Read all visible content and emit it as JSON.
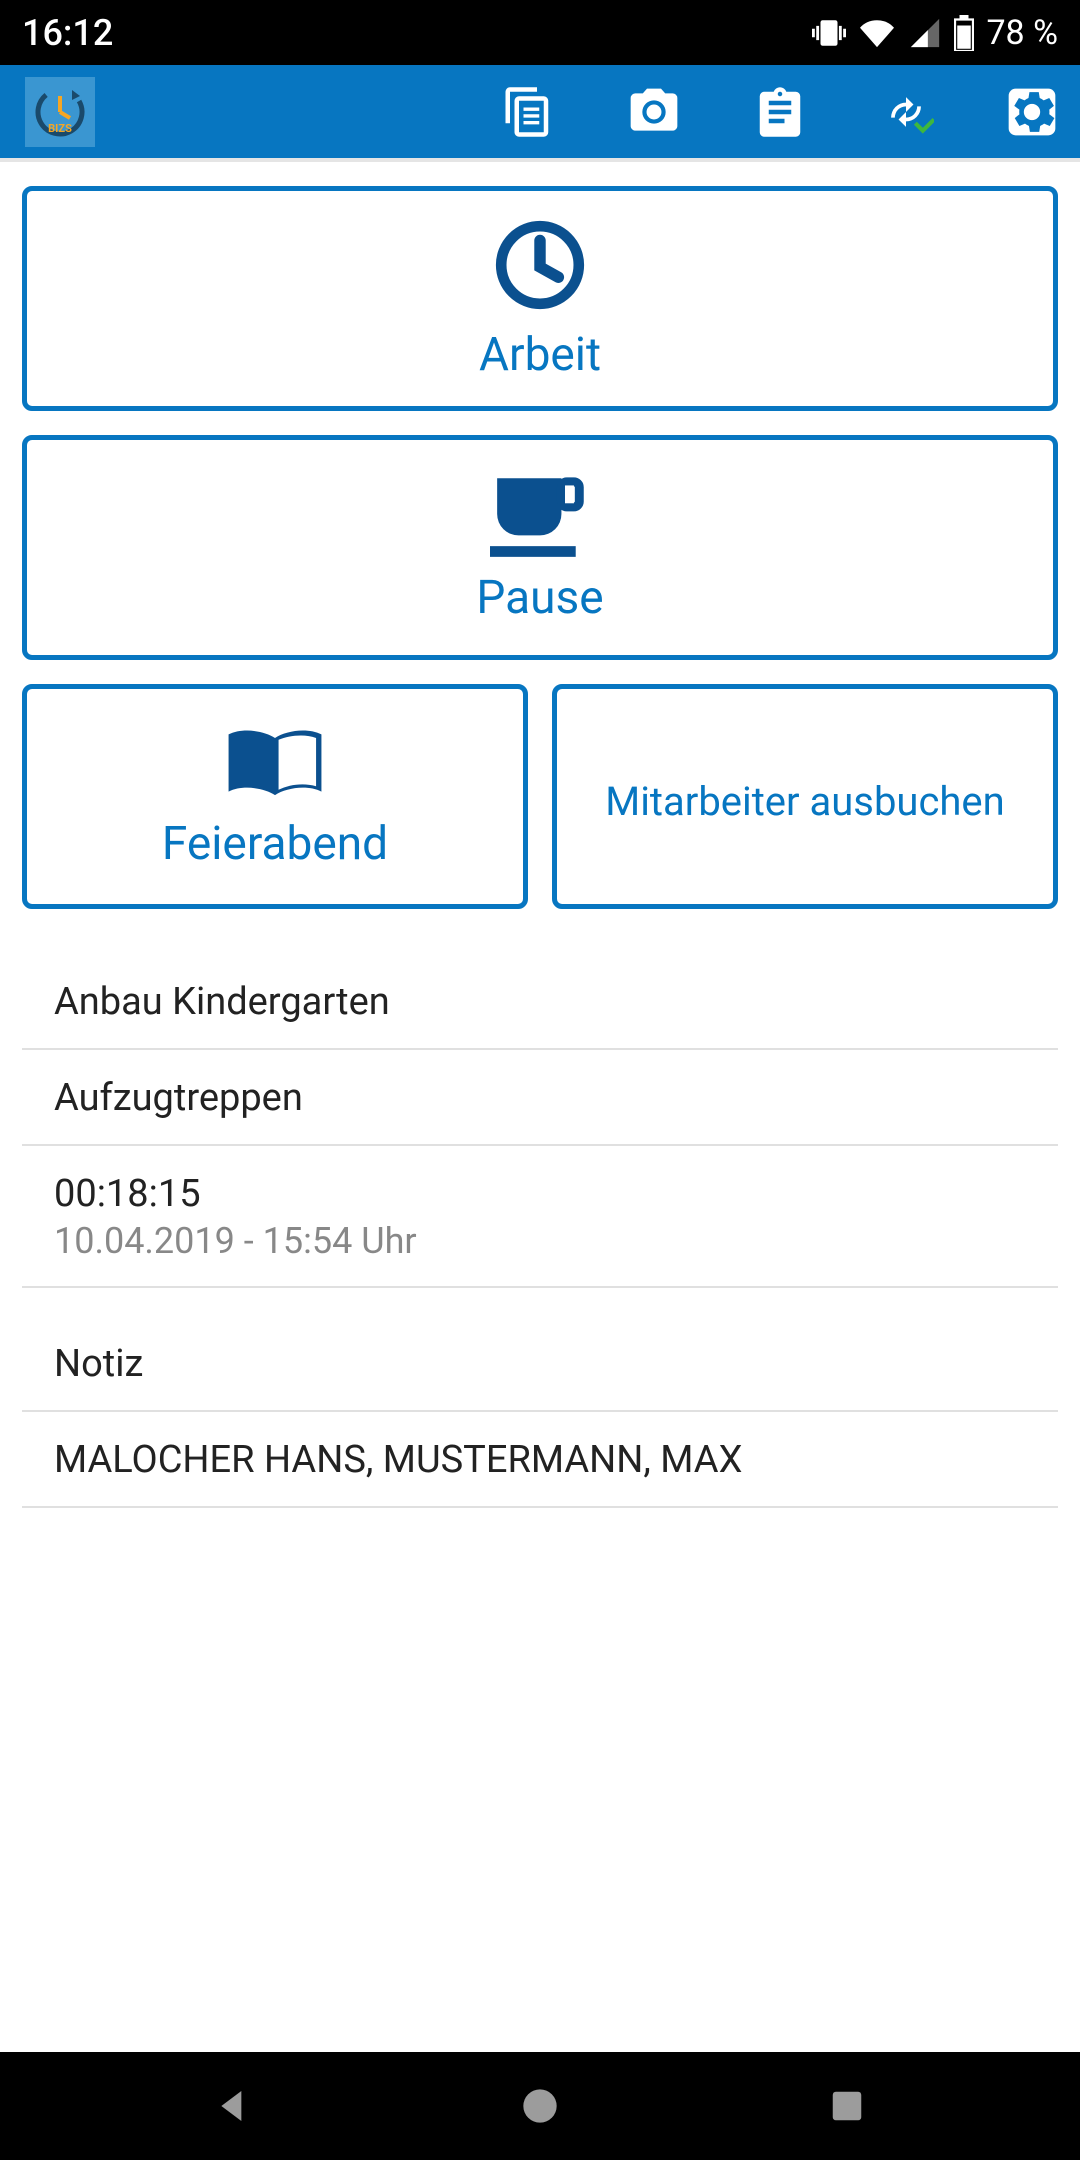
{
  "statusbar": {
    "time": "16:12",
    "battery": "78 %"
  },
  "buttons": {
    "arbeit": "Arbeit",
    "pause": "Pause",
    "feierabend": "Feierabend",
    "checkout": "Mitarbeiter ausbuchen"
  },
  "info": {
    "project": "Anbau Kindergarten",
    "task": "Aufzugtreppen",
    "duration": "00:18:15",
    "datetime": "10.04.2019 - 15:54 Uhr",
    "noteLabel": "Notiz",
    "workers": "MALOCHER HANS, MUSTERMANN, MAX"
  },
  "colors": {
    "primary": "#0776C1"
  }
}
